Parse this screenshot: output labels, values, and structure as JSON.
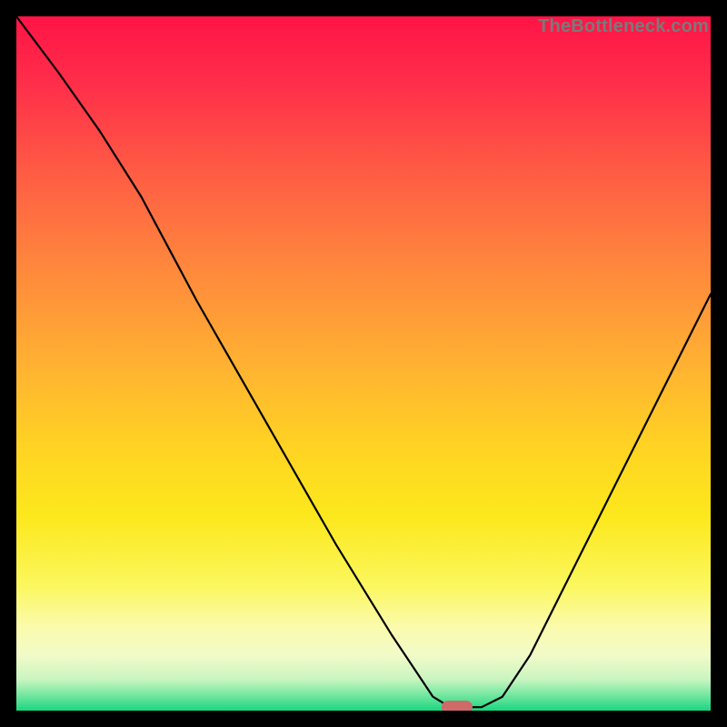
{
  "watermark": "TheBottleneck.com",
  "colors": {
    "frame": "#000000",
    "gradient_stops": [
      {
        "offset": 0.0,
        "color": "#ff1446"
      },
      {
        "offset": 0.1,
        "color": "#ff2f4a"
      },
      {
        "offset": 0.22,
        "color": "#ff5a44"
      },
      {
        "offset": 0.35,
        "color": "#ff843d"
      },
      {
        "offset": 0.5,
        "color": "#ffb132"
      },
      {
        "offset": 0.62,
        "color": "#ffd323"
      },
      {
        "offset": 0.72,
        "color": "#fce81c"
      },
      {
        "offset": 0.82,
        "color": "#fbf75e"
      },
      {
        "offset": 0.88,
        "color": "#fbfbad"
      },
      {
        "offset": 0.92,
        "color": "#f2fbc8"
      },
      {
        "offset": 0.955,
        "color": "#c9f5c0"
      },
      {
        "offset": 0.975,
        "color": "#7ee9a4"
      },
      {
        "offset": 1.0,
        "color": "#1ad67f"
      }
    ],
    "curve": "#000000",
    "marker": "#d06a68"
  },
  "chart_data": {
    "type": "line",
    "title": "",
    "xlabel": "",
    "ylabel": "",
    "xlim": [
      0,
      100
    ],
    "ylim": [
      0,
      100
    ],
    "x": [
      0,
      6,
      12,
      18,
      22,
      26,
      30,
      34,
      38,
      42,
      46,
      50,
      54,
      56,
      59,
      60,
      62,
      65,
      67,
      70,
      74,
      78,
      82,
      86,
      90,
      94,
      100
    ],
    "values": [
      100,
      92,
      83.5,
      74,
      66.5,
      59,
      52,
      45,
      38,
      31,
      24,
      17.5,
      11,
      8,
      3.5,
      2,
      0.8,
      0.5,
      0.5,
      2,
      8,
      16,
      24,
      32,
      40,
      48,
      60
    ],
    "marker": {
      "x": 63.5,
      "y": 0.5
    },
    "note": "x and y are percentages across the 764x764 plot area; y increases upward; curve inflection near x≈24 where the first segment's slope becomes slightly steeper."
  }
}
